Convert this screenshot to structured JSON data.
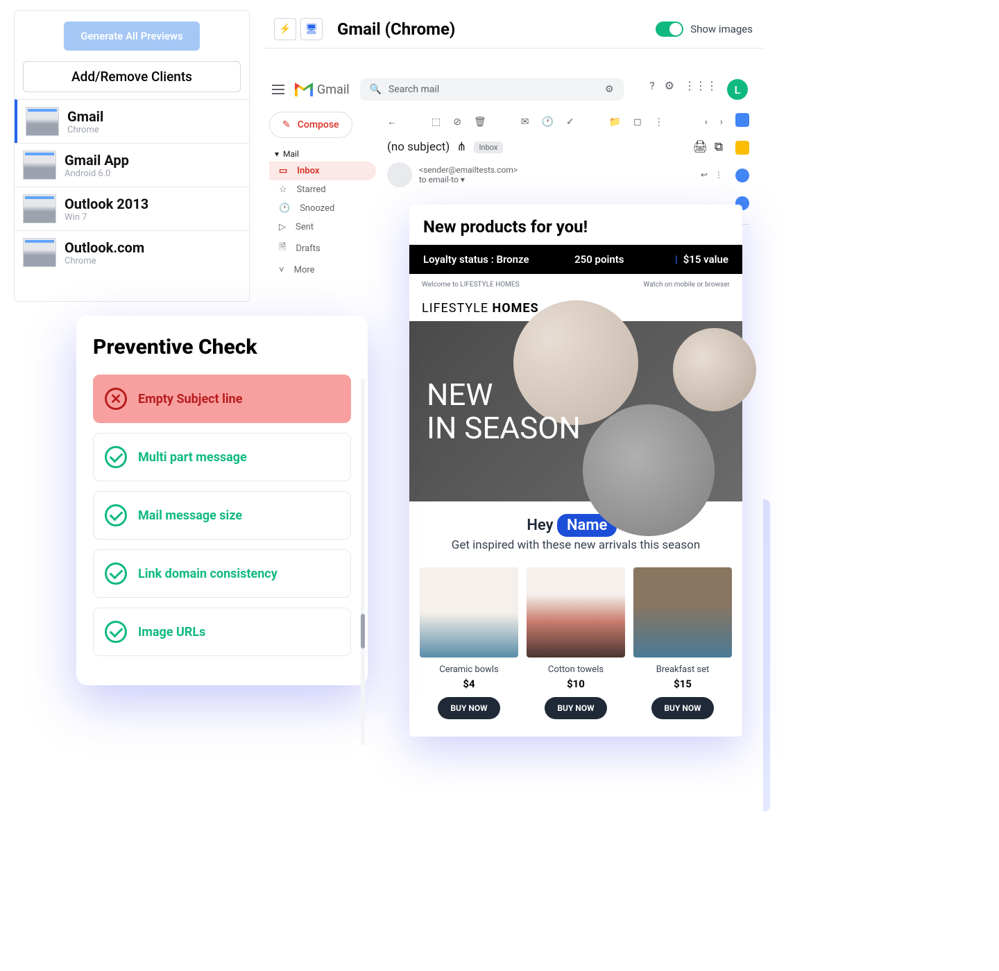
{
  "sidebar": {
    "generate_btn": "Generate All Previews",
    "add_remove": "Add/Remove Clients",
    "clients": [
      {
        "name": "Gmail",
        "sub": "Chrome"
      },
      {
        "name": "Gmail App",
        "sub": "Android 6.0"
      },
      {
        "name": "Outlook 2013",
        "sub": "Win 7"
      },
      {
        "name": "Outlook.com",
        "sub": "Chrome"
      }
    ]
  },
  "header": {
    "title": "Gmail (Chrome)",
    "show_images": "Show images"
  },
  "gmail": {
    "logo_text": "Gmail",
    "search_placeholder": "Search mail",
    "compose": "Compose",
    "mail_label": "Mail",
    "nav": [
      "Inbox",
      "Starred",
      "Snoozed",
      "Sent",
      "Drafts",
      "More"
    ],
    "subject": "(no subject)",
    "inbox_tag": "Inbox",
    "sender": "<sender@emailtests.com>",
    "recipient": "to email-to",
    "avatar_letter": "L"
  },
  "email": {
    "title": "New products for you!",
    "loyalty_status": "Loyalty status : Bronze",
    "points": "250 points",
    "value": "$15 value",
    "welcome": "Welcome to LIFESTYLE HOMES",
    "watch": "Watch on mobile or browser",
    "brand_prefix": "LIFESTYLE ",
    "brand_bold": "HOMES",
    "hero_line1": "NEW",
    "hero_line2": "IN SEASON",
    "greeting_prefix": "Hey ",
    "greeting_name": "Name",
    "greeting_suffix": " !",
    "subtitle": "Get inspired with these new arrivals this season",
    "products": [
      {
        "name": "Ceramic bowls",
        "price": "$4",
        "btn": "BUY NOW"
      },
      {
        "name": "Cotton towels",
        "price": "$10",
        "btn": "BUY NOW"
      },
      {
        "name": "Breakfast set",
        "price": "$15",
        "btn": "BUY NOW"
      }
    ]
  },
  "preventive": {
    "title": "Preventive Check",
    "checks": [
      {
        "label": "Empty Subject line",
        "status": "error"
      },
      {
        "label": "Multi part message",
        "status": "ok"
      },
      {
        "label": "Mail message size",
        "status": "ok"
      },
      {
        "label": "Link domain consistency",
        "status": "ok"
      },
      {
        "label": "Image URLs",
        "status": "ok"
      }
    ]
  }
}
